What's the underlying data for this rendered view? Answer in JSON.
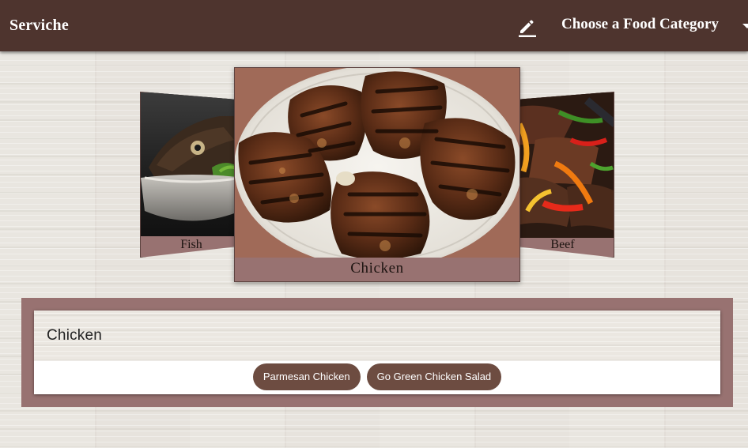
{
  "app": {
    "title": "Serviche"
  },
  "header": {
    "category_select": {
      "label": "Choose a Food Category"
    },
    "icons": {
      "edit": "pencil-icon",
      "dropdown": "caret-down-icon"
    }
  },
  "carousel": {
    "items": [
      {
        "caption": "Fish"
      },
      {
        "caption": "Chicken"
      },
      {
        "caption": "Beef"
      }
    ]
  },
  "recipes_panel": {
    "title": "Chicken",
    "recipes": [
      {
        "label": "Parmesan Chicken"
      },
      {
        "label": "Go Green Chicken Salad"
      }
    ]
  },
  "colors": {
    "header_bar": "#4e342e",
    "card_frame": "#987271",
    "chip": "#6d4c41",
    "background": "#e7e3dd"
  }
}
